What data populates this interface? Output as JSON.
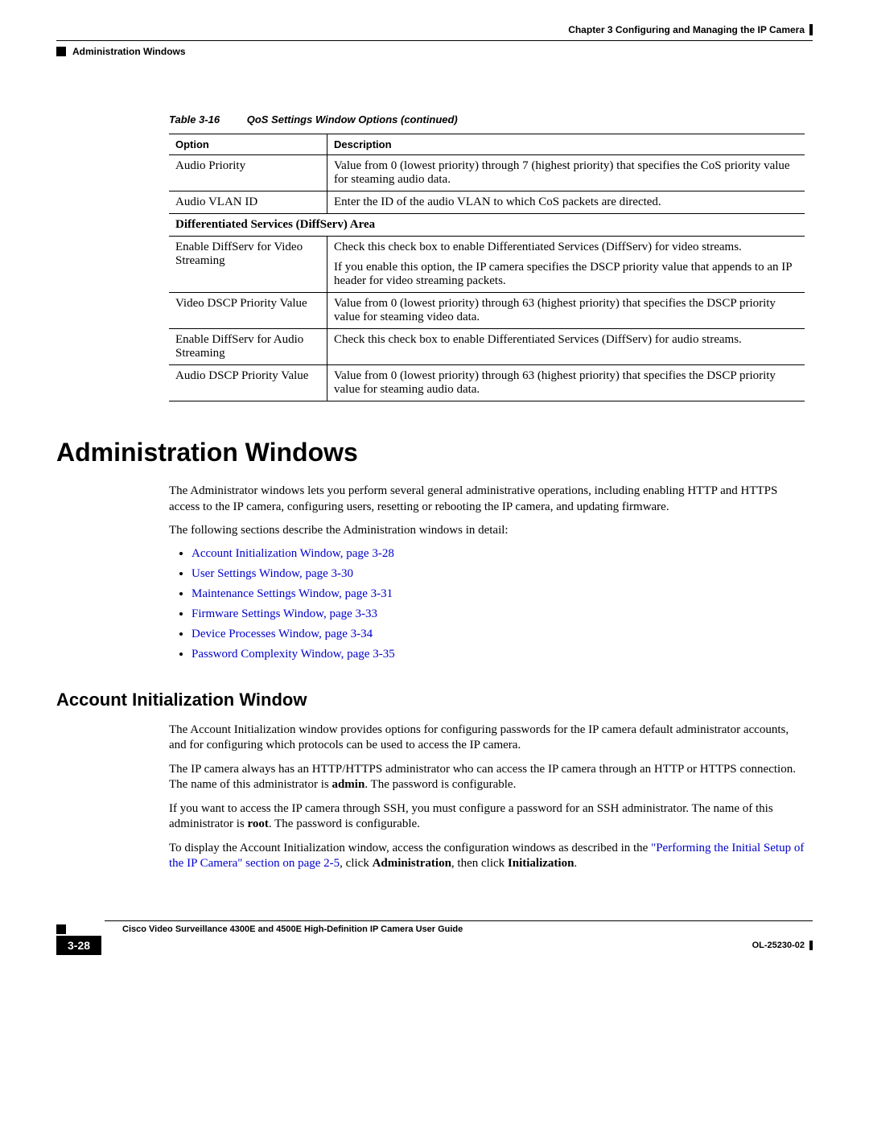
{
  "header": {
    "chapter": "Chapter 3      Configuring and Managing the IP Camera",
    "section": "Administration Windows"
  },
  "table": {
    "caption_num": "Table 3-16",
    "caption_text": "QoS Settings Window Options (continued)",
    "col_option": "Option",
    "col_desc": "Description",
    "rows": {
      "r0_opt": "Audio Priority",
      "r0_desc": "Value from 0 (lowest priority) through 7 (highest priority) that specifies the CoS priority value for steaming audio data.",
      "r1_opt": "Audio VLAN ID",
      "r1_desc": "Enter the ID of the audio VLAN to which CoS packets are directed.",
      "section": "Differentiated Services (DiffServ) Area",
      "r2_opt": "Enable DiffServ for Video Streaming",
      "r2_desc_a": "Check this check box to enable Differentiated Services (DiffServ) for video streams.",
      "r2_desc_b": "If you enable this option, the IP camera specifies the DSCP priority value that appends to an IP header for video streaming packets.",
      "r3_opt": "Video DSCP Priority Value",
      "r3_desc": "Value from 0 (lowest priority) through 63 (highest priority) that specifies the DSCP priority value for steaming video data.",
      "r4_opt": "Enable DiffServ for Audio Streaming",
      "r4_desc": "Check this check box to enable Differentiated Services (DiffServ) for audio streams.",
      "r5_opt": "Audio DSCP Priority Value",
      "r5_desc": "Value from 0 (lowest priority) through 63 (highest priority) that specifies the DSCP priority value for steaming audio data."
    }
  },
  "h1": "Administration Windows",
  "intro": {
    "p1": "The Administrator windows lets you perform several general administrative operations, including enabling HTTP and HTTPS access to the IP camera, configuring users, resetting or rebooting the IP camera, and updating firmware.",
    "p2": "The following sections describe the Administration windows in detail:"
  },
  "links": {
    "l0": "Account Initialization Window, page 3-28",
    "l1": "User Settings Window, page 3-30",
    "l2": "Maintenance Settings Window, page 3-31",
    "l3": "Firmware Settings Window, page 3-33",
    "l4": "Device Processes Window, page 3-34",
    "l5": "Password Complexity Window, page 3-35"
  },
  "h2": "Account Initialization Window",
  "acct": {
    "p1": "The Account Initialization window provides options for configuring passwords for the IP camera default administrator accounts, and for configuring which protocols can be used to access the IP camera.",
    "p2a": "The IP camera always has an HTTP/HTTPS administrator who can access the IP camera through an HTTP or HTTPS connection. The name of this administrator is ",
    "p2_bold1": "admin",
    "p2b": ". The password is configurable.",
    "p3a": "If you want to access the IP camera through SSH, you must configure a password for an SSH administrator. The name of this administrator is ",
    "p3_bold1": "root",
    "p3b": ". The password is configurable.",
    "p4a": "To display the Account Initialization window, access the configuration windows as described in the ",
    "p4_link": "\"Performing the Initial Setup of the IP Camera\" section on page 2-5",
    "p4b": ", click ",
    "p4_bold1": "Administration",
    "p4c": ", then click ",
    "p4_bold2": "Initialization",
    "p4d": "."
  },
  "footer": {
    "title": "Cisco Video Surveillance 4300E and 4500E High-Definition IP Camera User Guide",
    "page": "3-28",
    "doc": "OL-25230-02"
  }
}
